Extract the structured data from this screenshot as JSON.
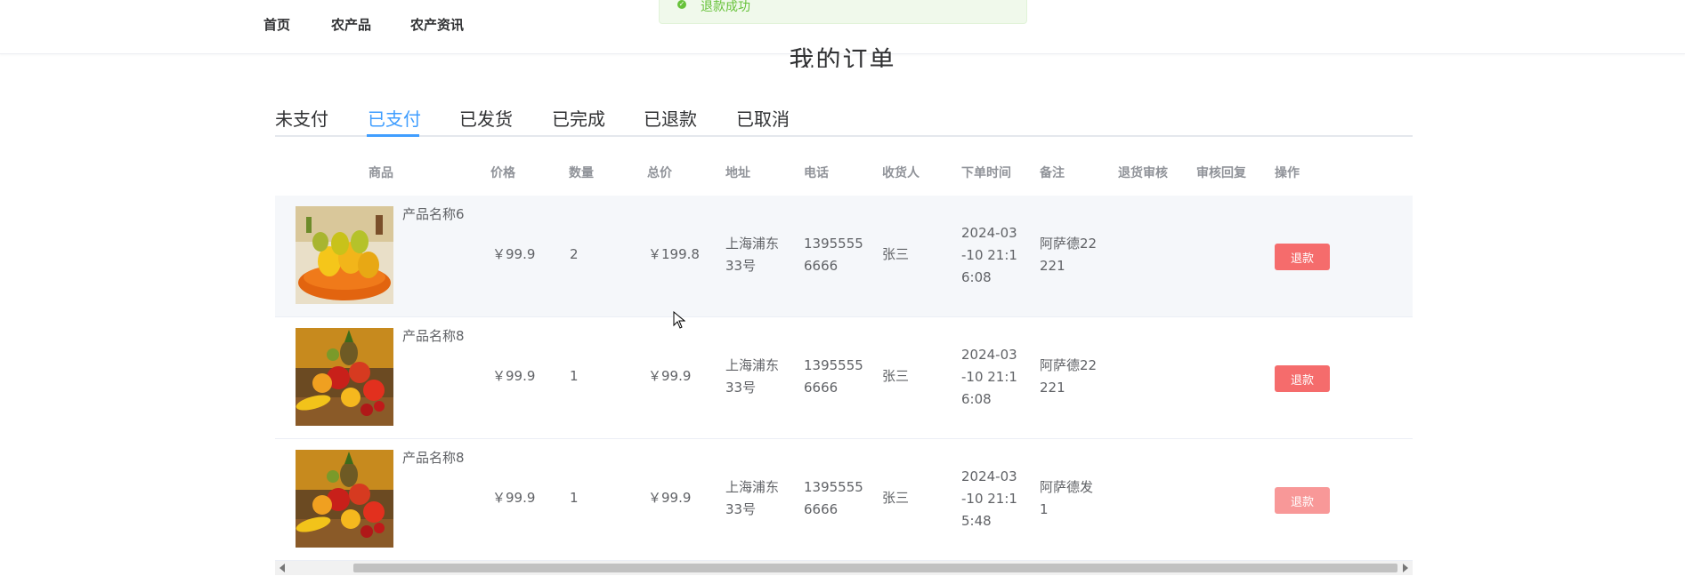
{
  "nav": {
    "items": [
      "首页",
      "农产品",
      "农产资讯"
    ]
  },
  "toast": {
    "message": "退款成功"
  },
  "page": {
    "title": "我的订单"
  },
  "tabs": {
    "items": [
      "未支付",
      "已支付",
      "已发货",
      "已完成",
      "已退款",
      "已取消"
    ],
    "active": "已支付"
  },
  "table": {
    "headers": [
      "商品",
      "价格",
      "数量",
      "总价",
      "地址",
      "电话",
      "收货人",
      "下单时间",
      "备注",
      "退货审核",
      "审核回复",
      "操作"
    ],
    "rows": [
      {
        "product": "产品名称6",
        "price": "￥99.9",
        "qty": "2",
        "total": "￥199.8",
        "addr1": "上海浦东",
        "addr2": "33号",
        "phone1": "1395555",
        "phone2": "6666",
        "receiver": "张三",
        "time1": "2024-03",
        "time2": "-10 21:1",
        "time3": "6:08",
        "note1": "阿萨德22",
        "note2": "221",
        "action": "退款"
      },
      {
        "product": "产品名称8",
        "price": "￥99.9",
        "qty": "1",
        "total": "￥99.9",
        "addr1": "上海浦东",
        "addr2": "33号",
        "phone1": "1395555",
        "phone2": "6666",
        "receiver": "张三",
        "time1": "2024-03",
        "time2": "-10 21:1",
        "time3": "6:08",
        "note1": "阿萨德22",
        "note2": "221",
        "action": "退款"
      },
      {
        "product": "产品名称8",
        "price": "￥99.9",
        "qty": "1",
        "total": "￥99.9",
        "addr1": "上海浦东",
        "addr2": "33号",
        "phone1": "1395555",
        "phone2": "6666",
        "receiver": "张三",
        "time1": "2024-03",
        "time2": "-10 21:1",
        "time3": "5:48",
        "note1": "阿萨德发",
        "note2": "1",
        "action": "退款"
      }
    ]
  },
  "colors": {
    "accent": "#409eff",
    "danger": "#f56c6c",
    "success": "#67c23a"
  }
}
